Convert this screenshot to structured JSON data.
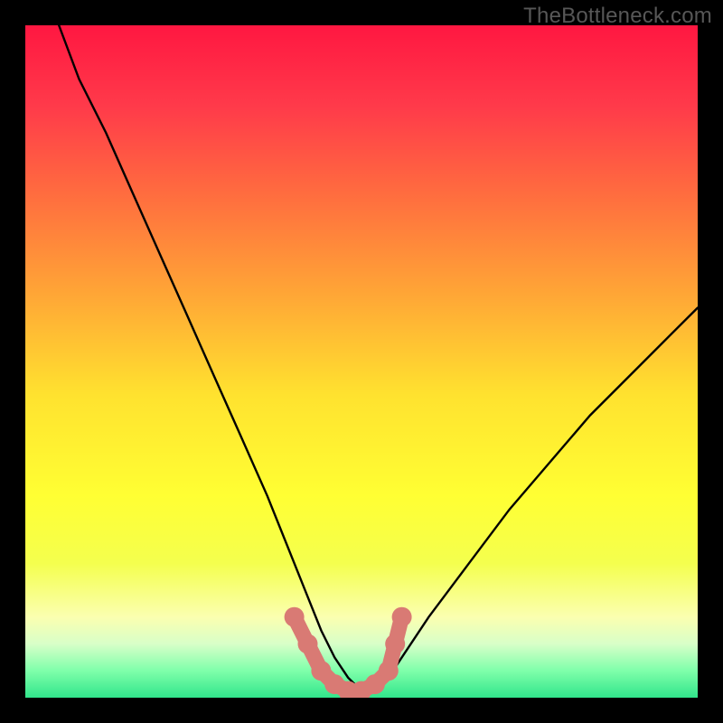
{
  "watermark": "TheBottleneck.com",
  "chart_data": {
    "type": "line",
    "title": "",
    "xlabel": "",
    "ylabel": "",
    "xlim": [
      0,
      100
    ],
    "ylim": [
      0,
      100
    ],
    "grid": false,
    "legend": false,
    "background": {
      "type": "vertical-gradient",
      "stops": [
        {
          "pos": 0.0,
          "color": "#ff1741"
        },
        {
          "pos": 0.12,
          "color": "#ff3a4a"
        },
        {
          "pos": 0.25,
          "color": "#ff6c3f"
        },
        {
          "pos": 0.4,
          "color": "#ffa636"
        },
        {
          "pos": 0.55,
          "color": "#ffe22f"
        },
        {
          "pos": 0.7,
          "color": "#ffff33"
        },
        {
          "pos": 0.8,
          "color": "#f4ff4e"
        },
        {
          "pos": 0.88,
          "color": "#fbffb0"
        },
        {
          "pos": 0.92,
          "color": "#d8ffc8"
        },
        {
          "pos": 0.96,
          "color": "#7fffaa"
        },
        {
          "pos": 1.0,
          "color": "#31e58b"
        }
      ]
    },
    "series": [
      {
        "name": "curve",
        "color": "#000000",
        "x": [
          5,
          8,
          12,
          16,
          20,
          24,
          28,
          32,
          36,
          38,
          40,
          42,
          44,
          46,
          48,
          50,
          52,
          54,
          56,
          60,
          66,
          72,
          78,
          84,
          90,
          96,
          100
        ],
        "y": [
          100,
          92,
          84,
          75,
          66,
          57,
          48,
          39,
          30,
          25,
          20,
          15,
          10,
          6,
          3,
          1,
          1,
          3,
          6,
          12,
          20,
          28,
          35,
          42,
          48,
          54,
          58
        ]
      }
    ],
    "highlight": {
      "name": "valley-highlight",
      "color": "#d97a74",
      "points": [
        {
          "x": 40,
          "y": 12
        },
        {
          "x": 42,
          "y": 8
        },
        {
          "x": 44,
          "y": 4
        },
        {
          "x": 46,
          "y": 2
        },
        {
          "x": 48,
          "y": 1
        },
        {
          "x": 50,
          "y": 1
        },
        {
          "x": 52,
          "y": 2
        },
        {
          "x": 54,
          "y": 4
        },
        {
          "x": 55,
          "y": 8
        },
        {
          "x": 56,
          "y": 12
        }
      ]
    }
  }
}
